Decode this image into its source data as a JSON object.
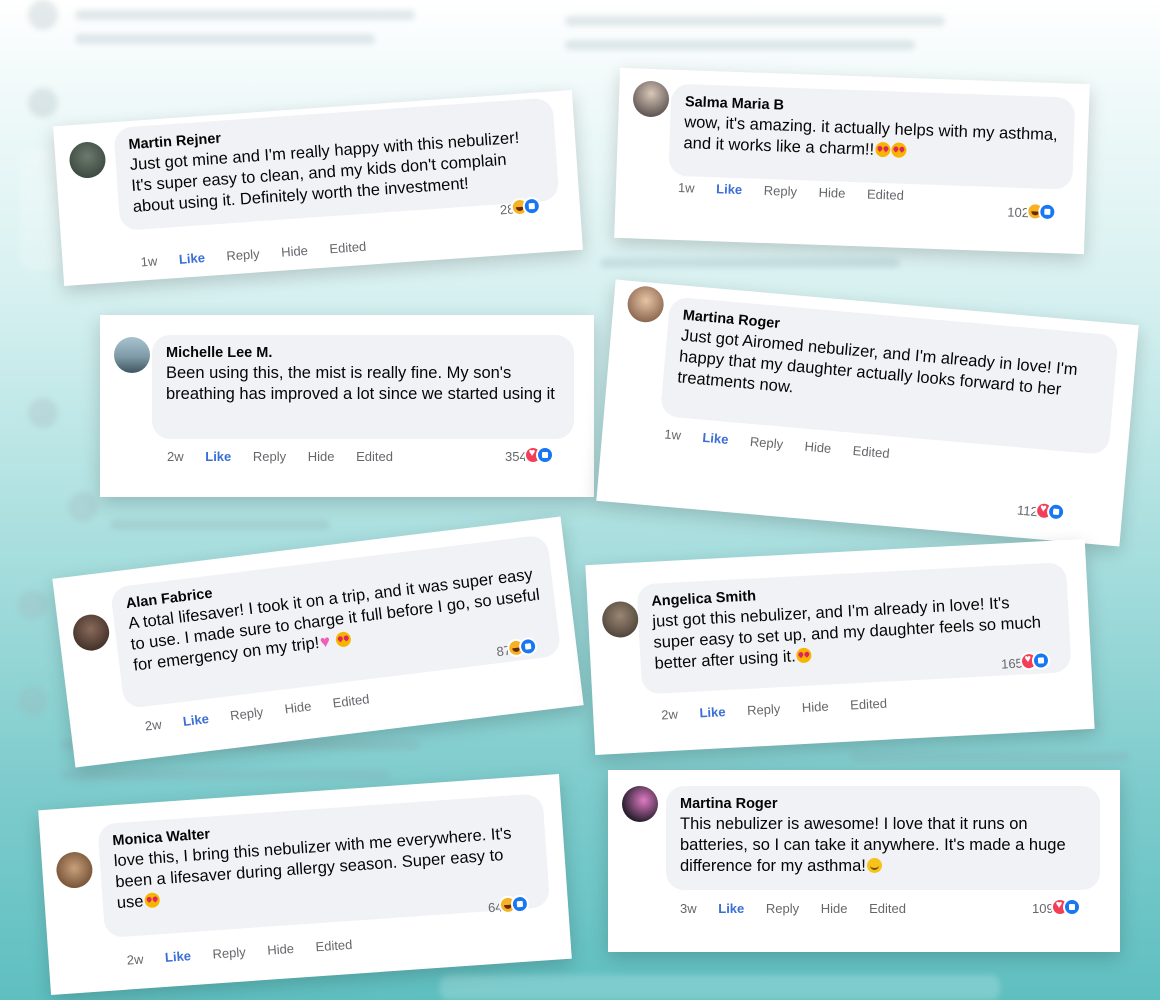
{
  "colors": {
    "bubble": "#f0f2f5",
    "like_blue": "#3b6fd6",
    "meta_gray": "#65676b",
    "background_teal": "#7fcccd"
  },
  "comments": [
    {
      "name": "Martin Rejner",
      "text": "Just got mine and I'm really happy with this nebulizer! It's super easy to clean, and my kids don't complain about using it. Definitely worth the investment!",
      "time": "1w",
      "like": "Like",
      "reply": "Reply",
      "hide": "Hide",
      "edited": "Edited",
      "count": "28",
      "reactions": [
        "haha",
        "like"
      ]
    },
    {
      "name": "Salma Maria B",
      "text": "wow, it's amazing. it actually helps with my asthma, and it works like a charm!!",
      "emojis": [
        "heart-eyes",
        "heart-eyes"
      ],
      "time": "1w",
      "like": "Like",
      "reply": "Reply",
      "hide": "Hide",
      "edited": "Edited",
      "count": "102",
      "reactions": [
        "haha",
        "like"
      ]
    },
    {
      "name": "Michelle Lee M.",
      "text": "Been using this, the mist is really fine. My son's breathing has improved a lot since we started using it",
      "time": "2w",
      "like": "Like",
      "reply": "Reply",
      "hide": "Hide",
      "edited": "Edited",
      "count": "354",
      "reactions": [
        "love",
        "like"
      ]
    },
    {
      "name": "Martina Roger",
      "text": "Just got Airomed nebulizer, and I'm already in love! I'm happy that my daughter actually looks forward to her treatments now.",
      "time": "1w",
      "like": "Like",
      "reply": "Reply",
      "hide": "Hide",
      "edited": "Edited",
      "count": "112",
      "reactions": [
        "love",
        "like"
      ]
    },
    {
      "name": "Alan Fabrice",
      "text": "A total lifesaver! I took it on a trip, and it was super easy to use. I made sure to charge it full before I go, so useful for emergency on my trip!",
      "emojis": [
        "pink-heart",
        "heart-eyes"
      ],
      "time": "2w",
      "like": "Like",
      "reply": "Reply",
      "hide": "Hide",
      "edited": "Edited",
      "count": "87",
      "reactions": [
        "haha",
        "like"
      ]
    },
    {
      "name": "Angelica Smith",
      "text": "just got this nebulizer, and I'm already in love! It's super easy to set up, and my daughter feels so much better after using it.",
      "emojis": [
        "heart-eyes"
      ],
      "time": "2w",
      "like": "Like",
      "reply": "Reply",
      "hide": "Hide",
      "edited": "Edited",
      "count": "165",
      "reactions": [
        "love",
        "like"
      ]
    },
    {
      "name": "Monica Walter",
      "text": "love this, I bring this nebulizer with me everywhere. It's been a lifesaver during allergy season. Super easy to use",
      "emojis": [
        "heart-eyes"
      ],
      "time": "2w",
      "like": "Like",
      "reply": "Reply",
      "hide": "Hide",
      "edited": "Edited",
      "count": "64",
      "reactions": [
        "haha",
        "like"
      ]
    },
    {
      "name": "Martina Roger",
      "text": "This nebulizer is awesome! I love that it runs on batteries, so I can take it anywhere. It's made a huge difference for my asthma!",
      "emojis": [
        "smile"
      ],
      "time": "3w",
      "like": "Like",
      "reply": "Reply",
      "hide": "Hide",
      "edited": "Edited",
      "count": "109",
      "reactions": [
        "love",
        "like"
      ]
    }
  ]
}
